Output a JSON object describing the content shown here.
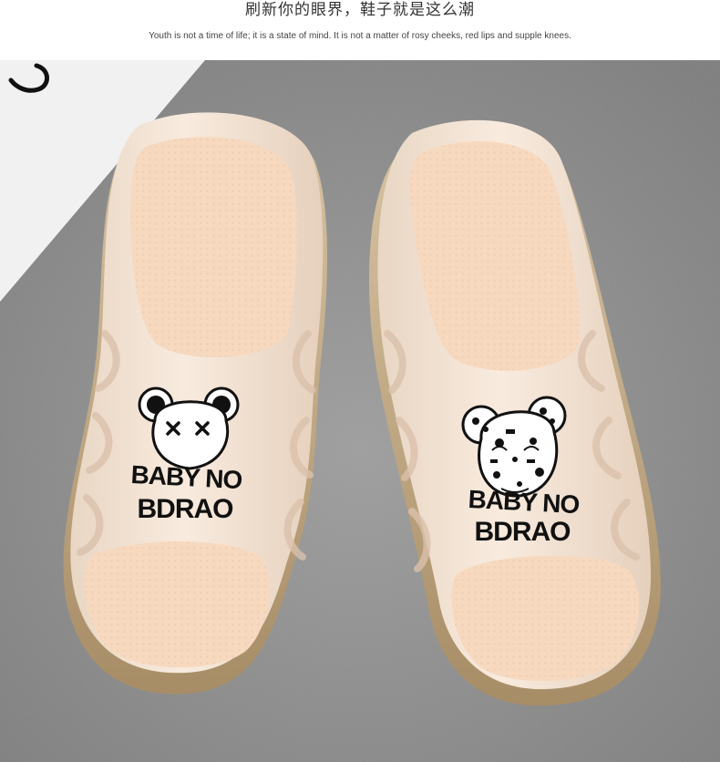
{
  "header": {
    "title": "刷新你的眼界，鞋子就是这么潮",
    "subtitle": "Youth is not a time of life; it is a state of mind. It is not a matter of rosy cheeks, red lips and supple knees."
  },
  "product_photo": {
    "left_slipper_print": {
      "line1": "BABY NO",
      "line2": "BDRAO"
    },
    "right_slipper_print": {
      "line1": "BABY NO",
      "line2": "BDRAO"
    },
    "colors": {
      "slipper_body": "#f4e2d2",
      "footbed": "#f6d9bf",
      "sole": "#b59e78",
      "background": "#8c8c8c",
      "paper": "#f1f1f1"
    }
  }
}
